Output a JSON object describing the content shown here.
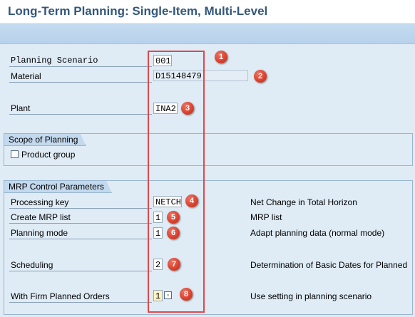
{
  "window": {
    "title": "Long-Term Planning: Single-Item, Multi-Level"
  },
  "header_fields": {
    "planning_scenario": {
      "label": "Planning Scenario",
      "value": "001"
    },
    "material": {
      "label": "Material",
      "value": "D15148479"
    },
    "plant": {
      "label": "Plant",
      "value": "INA2"
    }
  },
  "scope_of_planning": {
    "title": "Scope of Planning",
    "product_group": {
      "label": "Product group",
      "checked": false
    }
  },
  "mrp_control": {
    "title": "MRP Control Parameters",
    "processing_key": {
      "label": "Processing key",
      "value": "NETCH",
      "description": "Net Change in Total Horizon"
    },
    "create_mrp_list": {
      "label": "Create MRP list",
      "value": "1",
      "description": "MRP list"
    },
    "planning_mode": {
      "label": "Planning mode",
      "value": "1",
      "description": "Adapt planning data (normal mode)"
    },
    "scheduling": {
      "label": "Scheduling",
      "value": "2",
      "description": "Determination of Basic Dates for Planned"
    },
    "firm_planned_orders": {
      "label": "With Firm Planned Orders",
      "value": "1",
      "description": "Use setting in planning scenario"
    }
  },
  "callouts": [
    "1",
    "2",
    "3",
    "4",
    "5",
    "6",
    "7",
    "8"
  ],
  "colors": {
    "title": "#34577b",
    "callout": "#d8402c",
    "highlight_box": "#e0484a"
  }
}
